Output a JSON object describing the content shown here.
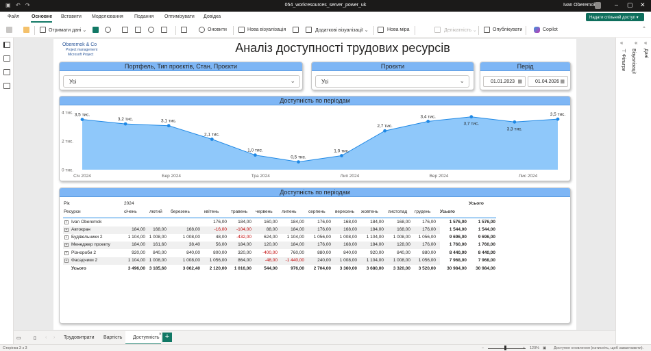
{
  "app": {
    "filename": "054_workresources_server_power_uk",
    "user": "Ivan Oberemok"
  },
  "menu": [
    "Файл",
    "Основне",
    "Вставити",
    "Моделювання",
    "Подання",
    "Оптимізувати",
    "Довідка"
  ],
  "share_label": "Надати спільний доступ",
  "ribbon": {
    "get_data": "Отримати дані",
    "refresh": "Оновити",
    "new_visual": "Нова візуалізація",
    "more_visuals": "Додаткові візуалізації",
    "new_measure": "Нова міра",
    "sensitivity": "Делікатність",
    "publish": "Опублікувати",
    "copilot": "Copilot"
  },
  "report": {
    "logo_name": "Oberemok & Co",
    "logo_line2": "Project management",
    "logo_line3": "Microsoft Project",
    "title": "Аналіз доступності трудових ресурсів",
    "slicer1": {
      "header": "Портфель, Тип проєктів, Стан, Проєкти",
      "value": "Усі"
    },
    "slicer2": {
      "header": "Проєкти",
      "value": "Усі"
    },
    "slicer3": {
      "header": "Перід",
      "from": "01.01.2023",
      "to": "01.04.2026"
    },
    "chart_header": "Доступність по періодам",
    "matrix_header": "Доступність по періодам"
  },
  "chart_data": {
    "type": "area",
    "x": [
      "2024-01",
      "2024-02",
      "2024-03",
      "2024-04",
      "2024-05",
      "2024-06",
      "2024-07",
      "2024-08",
      "2024-09",
      "2024-10",
      "2024-11",
      "2024-12"
    ],
    "values": [
      3496,
      3185.6,
      3062.4,
      2120,
      1016,
      544,
      976,
      2704,
      3360,
      3680,
      3320,
      3520
    ],
    "data_labels": [
      "3,5 тис.",
      "3,2 тис.",
      "3,1 тис.",
      "2,1 тис.",
      "1,0 тис.",
      "0,5 тис.",
      "1,0 тис.",
      "2,7 тис.",
      "3,4 тис.",
      "3,7 тис.",
      "3,3 тис.",
      "3,5 тис."
    ],
    "y_ticks": [
      "0 тис.",
      "2 тис.",
      "4 тис."
    ],
    "ylim": [
      0,
      4000
    ],
    "x_ticks": [
      {
        "i": 0,
        "label": "Січ 2024"
      },
      {
        "i": 3,
        "label": "Бер 2024"
      },
      {
        "i": 6,
        "label": "Тра 2024"
      },
      {
        "i": 9,
        "label": "Лип 2024"
      },
      {
        "i": 12,
        "label": "Вер 2024"
      },
      {
        "i": 15,
        "label": "Лис 2024"
      }
    ],
    "color": "#8fc8fa",
    "line_color": "#1e88e5",
    "grid": false
  },
  "matrix": {
    "col_header_label": "Рік",
    "row_header_label": "Ресурси",
    "year": "2024",
    "total_label": "Усього",
    "months": [
      "січень",
      "лютий",
      "березень",
      "квітень",
      "травень",
      "червень",
      "липень",
      "серпень",
      "вересень",
      "жовтень",
      "листопад",
      "грудень"
    ],
    "rows": [
      {
        "name": "Ivan Oberemok",
        "values": [
          "",
          "",
          "",
          "176,00",
          "184,00",
          "160,00",
          "184,00",
          "176,00",
          "168,00",
          "184,00",
          "168,00",
          "176,00"
        ],
        "total": "1 576,00",
        "grand": "1 576,00"
      },
      {
        "name": "Автокран",
        "values": [
          "184,00",
          "168,00",
          "168,00",
          "-16,00",
          "-104,00",
          "88,00",
          "184,00",
          "176,00",
          "168,00",
          "184,00",
          "168,00",
          "176,00"
        ],
        "total": "1 544,00",
        "grand": "1 544,00"
      },
      {
        "name": "Будівельники 2",
        "values": [
          "1 104,00",
          "1 008,00",
          "1 008,00",
          "48,00",
          "-432,00",
          "624,00",
          "1 104,00",
          "1 056,00",
          "1 008,00",
          "1 104,00",
          "1 008,00",
          "1 056,00"
        ],
        "total": "9 696,00",
        "grand": "9 696,00"
      },
      {
        "name": "Менеджер проекту",
        "values": [
          "184,00",
          "161,60",
          "38,40",
          "56,00",
          "184,00",
          "120,00",
          "184,00",
          "176,00",
          "168,00",
          "184,00",
          "128,00",
          "176,00"
        ],
        "total": "1 760,00",
        "grand": "1 760,00"
      },
      {
        "name": "Різнороби 2",
        "values": [
          "920,00",
          "840,00",
          "840,00",
          "800,00",
          "320,00",
          "-400,00",
          "760,00",
          "880,00",
          "840,00",
          "920,00",
          "840,00",
          "880,00"
        ],
        "total": "8 440,00",
        "grand": "8 440,00"
      },
      {
        "name": "Фасадчики 2",
        "values": [
          "1 104,00",
          "1 008,00",
          "1 008,00",
          "1 056,00",
          "864,00",
          "-48,00",
          "-1 440,00",
          "240,00",
          "1 008,00",
          "1 104,00",
          "1 008,00",
          "1 056,00"
        ],
        "total": "7 968,00",
        "grand": "7 968,00"
      }
    ],
    "totals": {
      "values": [
        "3 496,00",
        "3 185,60",
        "3 062,40",
        "2 120,00",
        "1 016,00",
        "544,00",
        "976,00",
        "2 704,00",
        "3 360,00",
        "3 680,00",
        "3 320,00",
        "3 520,00"
      ],
      "total": "30 984,00",
      "grand": "30 984,00"
    }
  },
  "tabs": [
    "Трудовитрати",
    "Вартість",
    "Доступність"
  ],
  "status": {
    "page": "Сторінка 3 з 3",
    "zoom": "120%",
    "update": "Доступне оновлення (натисніть, щоб завантажити)."
  },
  "panes": {
    "filters": "Фільтри",
    "visualizations": "Візуалізації",
    "data": "Дані"
  },
  "colors": {
    "accent": "#117865",
    "header_blue": "#7eb6f5"
  }
}
